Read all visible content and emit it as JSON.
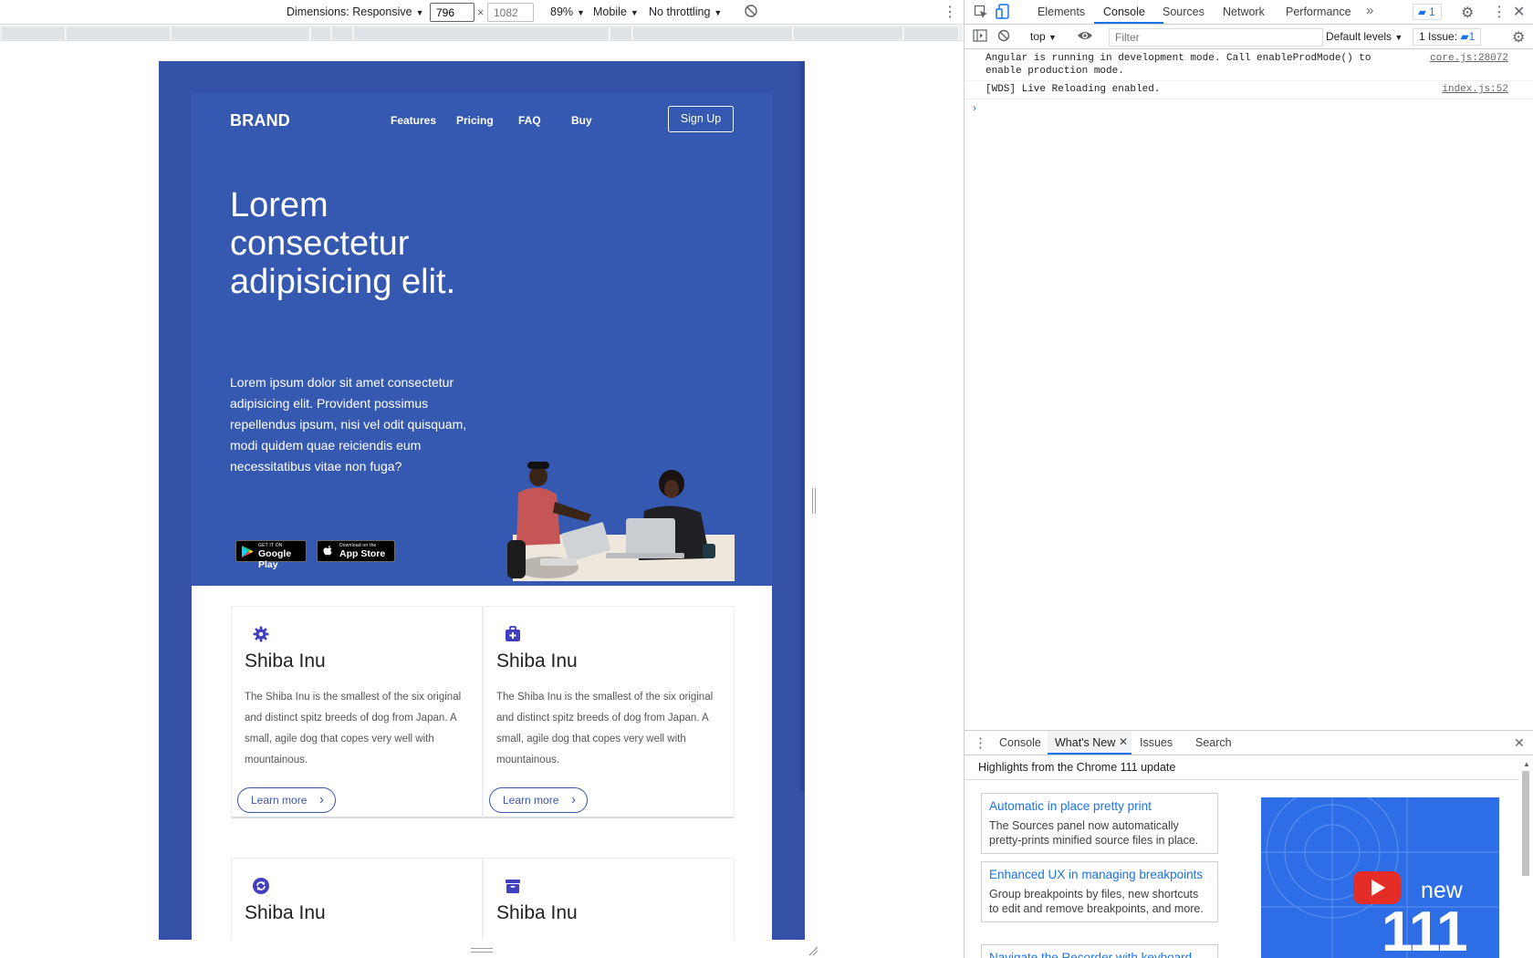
{
  "device_toolbar": {
    "dimensions_label": "Dimensions: Responsive",
    "width_value": "796",
    "height_placeholder": "1082",
    "times_sign": "×",
    "zoom": "89%",
    "device_type": "Mobile",
    "throttling": "No throttling"
  },
  "page": {
    "brand": "BRAND",
    "nav": [
      "Features",
      "Pricing",
      "FAQ",
      "Buy"
    ],
    "signup": "Sign Up",
    "hero_title": "Lorem consectetur adipisicing elit.",
    "hero_text": "Lorem ipsum dolor sit amet consectetur adipisicing elit. Provident possimus repellendus ipsum, nisi vel odit quisquam, modi quidem quae reiciendis eum necessitatibus vitae non fuga?",
    "google_play": {
      "small": "GET IT ON",
      "large": "Google Play"
    },
    "app_store": {
      "small": "Download on the",
      "large": "App Store"
    },
    "features": [
      {
        "icon": "gear-icon",
        "title": "Shiba Inu",
        "text": "The Shiba Inu is the smallest of the six original and distinct spitz breeds of dog from Japan. A small, agile dog that copes very well with mountainous.",
        "button": "Learn more"
      },
      {
        "icon": "medkit-icon",
        "title": "Shiba Inu",
        "text": "The Shiba Inu is the smallest of the six original and distinct spitz breeds of dog from Japan. A small, agile dog that copes very well with mountainous.",
        "button": "Learn more"
      },
      {
        "icon": "sync-icon",
        "title": "Shiba Inu"
      },
      {
        "icon": "archive-icon",
        "title": "Shiba Inu"
      }
    ]
  },
  "devtools": {
    "tabs": [
      "Elements",
      "Console",
      "Sources",
      "Network",
      "Performance"
    ],
    "active_tab": "Console",
    "message_count": "1",
    "context": "top",
    "filter_placeholder": "Filter",
    "levels": "Default levels",
    "issues": "1 Issue:",
    "issues_count": "1",
    "console_messages": [
      {
        "text": "Angular is running in development mode. Call enableProdMode() to enable production mode.",
        "source": "core.js:28072"
      },
      {
        "text": "[WDS] Live Reloading enabled.",
        "source": "index.js:52"
      }
    ],
    "drawer": {
      "tabs": [
        "Console",
        "What's New",
        "Issues",
        "Search"
      ],
      "active_tab": "What's New",
      "heading": "Highlights from the Chrome 111 update",
      "cards": [
        {
          "title": "Automatic in place pretty print",
          "desc": "The Sources panel now automatically pretty-prints minified source files in place."
        },
        {
          "title": "Enhanced UX in managing breakpoints",
          "desc": "Group breakpoints by files, new shortcuts to edit and remove breakpoints, and more."
        },
        {
          "title": "Navigate the Recorder with keyboard",
          "desc": ""
        }
      ],
      "video": {
        "word": "new",
        "number": "111"
      }
    }
  },
  "colors": {
    "hero_blue": "#3558b0",
    "device_bg": "#3453a8",
    "devtools_accent": "#1a73e8",
    "feature_icon": "#3f3fbf"
  }
}
